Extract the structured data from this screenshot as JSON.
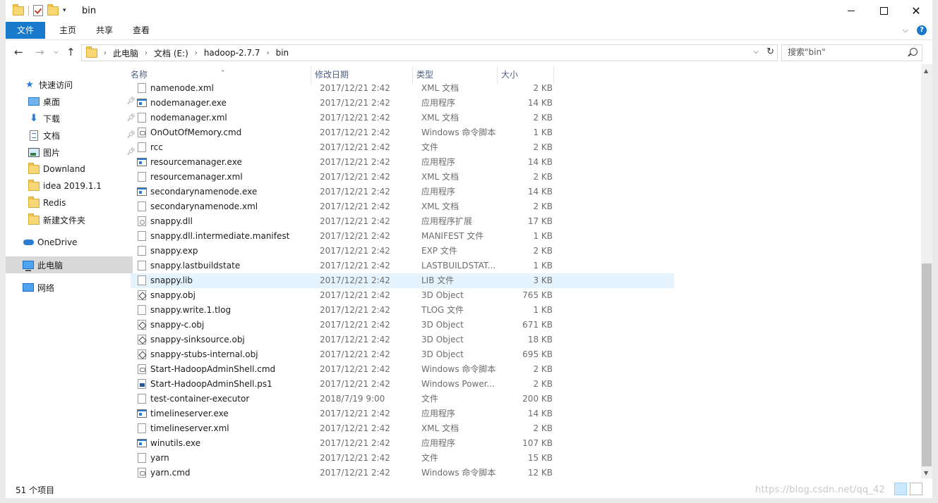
{
  "window": {
    "title": "bin",
    "controls": {
      "minimize": "—",
      "maximize": "□",
      "close": "✕"
    }
  },
  "ribbon": {
    "tabs": [
      "文件",
      "主页",
      "共享",
      "查看"
    ],
    "help": "?"
  },
  "address": {
    "crumbs": [
      "此电脑",
      "文档 (E:)",
      "hadoop-2.7.7",
      "bin"
    ]
  },
  "search": {
    "placeholder": "搜索\"bin\""
  },
  "sidebar": {
    "quick_access": "快速访问",
    "pinned": [
      {
        "label": "桌面",
        "icon": "desktop-icon"
      },
      {
        "label": "下载",
        "icon": "download-icon"
      },
      {
        "label": "文档",
        "icon": "document-icon"
      },
      {
        "label": "图片",
        "icon": "pictures-icon"
      }
    ],
    "folders": [
      "Downland",
      "idea 2019.1.1",
      "Redis",
      "新建文件夹"
    ],
    "onedrive": "OneDrive",
    "this_pc": "此电脑",
    "network": "网络"
  },
  "columns": {
    "name": "名称",
    "modified": "修改日期",
    "type": "类型",
    "size": "大小"
  },
  "files": [
    {
      "name": "namenode.xml",
      "modified": "2017/12/21 2:42",
      "type": "XML 文档",
      "size": "2 KB",
      "icon": "file"
    },
    {
      "name": "nodemanager.exe",
      "modified": "2017/12/21 2:42",
      "type": "应用程序",
      "size": "14 KB",
      "icon": "exe"
    },
    {
      "name": "nodemanager.xml",
      "modified": "2017/12/21 2:42",
      "type": "XML 文档",
      "size": "2 KB",
      "icon": "file"
    },
    {
      "name": "OnOutOfMemory.cmd",
      "modified": "2017/12/21 2:42",
      "type": "Windows 命令脚本",
      "size": "1 KB",
      "icon": "cmd"
    },
    {
      "name": "rcc",
      "modified": "2017/12/21 2:42",
      "type": "文件",
      "size": "2 KB",
      "icon": "file"
    },
    {
      "name": "resourcemanager.exe",
      "modified": "2017/12/21 2:42",
      "type": "应用程序",
      "size": "14 KB",
      "icon": "exe"
    },
    {
      "name": "resourcemanager.xml",
      "modified": "2017/12/21 2:42",
      "type": "XML 文档",
      "size": "2 KB",
      "icon": "file"
    },
    {
      "name": "secondarynamenode.exe",
      "modified": "2017/12/21 2:42",
      "type": "应用程序",
      "size": "14 KB",
      "icon": "exe"
    },
    {
      "name": "secondarynamenode.xml",
      "modified": "2017/12/21 2:42",
      "type": "XML 文档",
      "size": "2 KB",
      "icon": "file"
    },
    {
      "name": "snappy.dll",
      "modified": "2017/12/21 2:42",
      "type": "应用程序扩展",
      "size": "17 KB",
      "icon": "dll"
    },
    {
      "name": "snappy.dll.intermediate.manifest",
      "modified": "2017/12/21 2:42",
      "type": "MANIFEST 文件",
      "size": "1 KB",
      "icon": "file"
    },
    {
      "name": "snappy.exp",
      "modified": "2017/12/21 2:42",
      "type": "EXP 文件",
      "size": "2 KB",
      "icon": "file"
    },
    {
      "name": "snappy.lastbuildstate",
      "modified": "2017/12/21 2:42",
      "type": "LASTBUILDSTAT...",
      "size": "1 KB",
      "icon": "file"
    },
    {
      "name": "snappy.lib",
      "modified": "2017/12/21 2:42",
      "type": "LIB 文件",
      "size": "3 KB",
      "icon": "file",
      "selected": true
    },
    {
      "name": "snappy.obj",
      "modified": "2017/12/21 2:42",
      "type": "3D Object",
      "size": "765 KB",
      "icon": "obj"
    },
    {
      "name": "snappy.write.1.tlog",
      "modified": "2017/12/21 2:42",
      "type": "TLOG 文件",
      "size": "1 KB",
      "icon": "file"
    },
    {
      "name": "snappy-c.obj",
      "modified": "2017/12/21 2:42",
      "type": "3D Object",
      "size": "671 KB",
      "icon": "obj"
    },
    {
      "name": "snappy-sinksource.obj",
      "modified": "2017/12/21 2:42",
      "type": "3D Object",
      "size": "18 KB",
      "icon": "obj"
    },
    {
      "name": "snappy-stubs-internal.obj",
      "modified": "2017/12/21 2:42",
      "type": "3D Object",
      "size": "695 KB",
      "icon": "obj"
    },
    {
      "name": "Start-HadoopAdminShell.cmd",
      "modified": "2017/12/21 2:42",
      "type": "Windows 命令脚本",
      "size": "2 KB",
      "icon": "cmd"
    },
    {
      "name": "Start-HadoopAdminShell.ps1",
      "modified": "2017/12/21 2:42",
      "type": "Windows Power...",
      "size": "2 KB",
      "icon": "ps1"
    },
    {
      "name": "test-container-executor",
      "modified": "2018/7/19 9:00",
      "type": "文件",
      "size": "200 KB",
      "icon": "file"
    },
    {
      "name": "timelineserver.exe",
      "modified": "2017/12/21 2:42",
      "type": "应用程序",
      "size": "14 KB",
      "icon": "exe"
    },
    {
      "name": "timelineserver.xml",
      "modified": "2017/12/21 2:42",
      "type": "XML 文档",
      "size": "2 KB",
      "icon": "file"
    },
    {
      "name": "winutils.exe",
      "modified": "2017/12/21 2:42",
      "type": "应用程序",
      "size": "107 KB",
      "icon": "exe"
    },
    {
      "name": "yarn",
      "modified": "2017/12/21 2:42",
      "type": "文件",
      "size": "15 KB",
      "icon": "file"
    },
    {
      "name": "yarn.cmd",
      "modified": "2017/12/21 2:42",
      "type": "Windows 命令脚本",
      "size": "12 KB",
      "icon": "cmd"
    }
  ],
  "status": {
    "item_count": "51 个项目"
  },
  "watermark": "https://blog.csdn.net/qq_42"
}
